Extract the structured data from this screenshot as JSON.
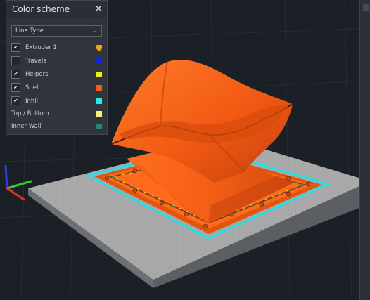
{
  "panel": {
    "title": "Color scheme",
    "close_glyph": "✕",
    "select_value": "Line Type",
    "items": [
      {
        "label": "Extruder 1",
        "checked": true,
        "color": "#f7a11b"
      },
      {
        "label": "Travels",
        "checked": false,
        "color": "#1122dd"
      },
      {
        "label": "Helpers",
        "checked": true,
        "color": "#f2ec1a"
      },
      {
        "label": "Shell",
        "checked": true,
        "color": "#f2591c"
      },
      {
        "label": "Infill",
        "checked": true,
        "color": "#1ff0ee"
      }
    ],
    "legend": [
      {
        "label": "Top / Bottom",
        "color": "#f5f07a"
      },
      {
        "label": "Inner Wall",
        "color": "#1c8a6c"
      }
    ]
  },
  "scene": {
    "model_color": "#f25a14",
    "outline_color": "#22e0e6",
    "bed_color": "#a9a9a9",
    "grid_line_color": "#c4c4c4",
    "axes": {
      "x": "#e03030",
      "y": "#2ecc2e",
      "z": "#2a3de0"
    }
  }
}
